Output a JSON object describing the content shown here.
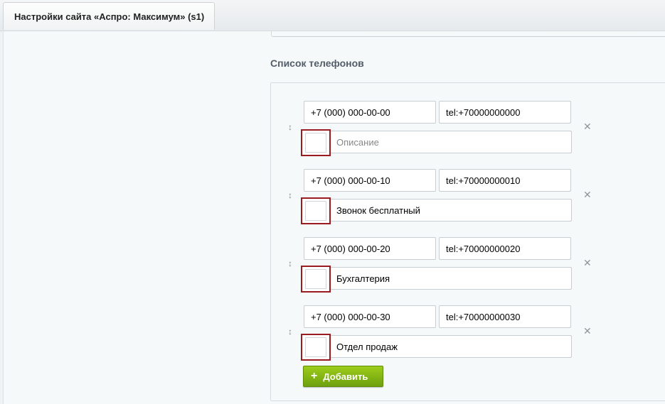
{
  "tab": {
    "title": "Настройки сайта «Аспро: Максимум» (s1)"
  },
  "section": {
    "title": "Список телефонов"
  },
  "phones": [
    {
      "phone": "+7 (000) 000-00-00",
      "href": "tel:+70000000000",
      "description": "",
      "description_placeholder": "Описание"
    },
    {
      "phone": "+7 (000) 000-00-10",
      "href": "tel:+70000000010",
      "description": "Звонок бесплатный",
      "description_placeholder": ""
    },
    {
      "phone": "+7 (000) 000-00-20",
      "href": "tel:+70000000020",
      "description": "Бухгалтерия",
      "description_placeholder": ""
    },
    {
      "phone": "+7 (000) 000-00-30",
      "href": "tel:+70000000030",
      "description": "Отдел продаж",
      "description_placeholder": ""
    }
  ],
  "icons": {
    "drag": "↕",
    "remove": "✕",
    "plus": "+"
  },
  "add_button": {
    "label": "Добавить"
  },
  "colors": {
    "accent": "#7ab215",
    "icon_border": "#9b1c20"
  }
}
